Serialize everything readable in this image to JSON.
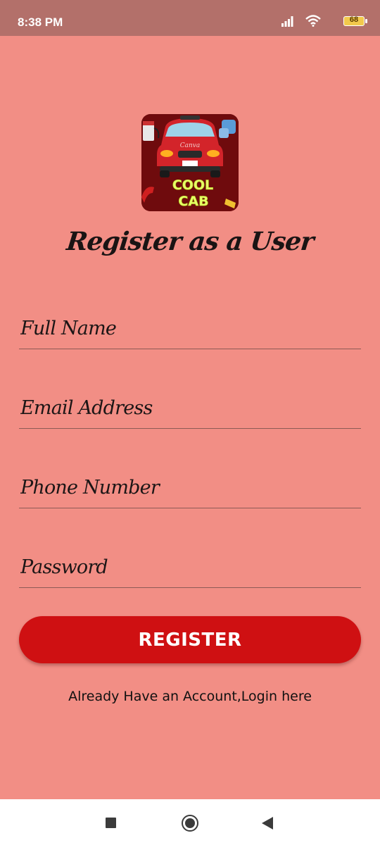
{
  "status_bar": {
    "time": "8:38 PM",
    "battery_level": "68",
    "icons": [
      "signal-icon",
      "wifi-icon",
      "battery-icon"
    ]
  },
  "logo": {
    "line1": "COOL",
    "line2": "CAB",
    "plate_text": "Canva"
  },
  "page": {
    "title": "Register as a User"
  },
  "form": {
    "full_name_placeholder": "Full Name",
    "email_placeholder": "Email Address",
    "phone_placeholder": "Phone Number",
    "password_placeholder": "Password",
    "register_label": "REGISTER",
    "login_link": "Already Have an Account,Login here"
  },
  "colors": {
    "background": "#f28e85",
    "status_bar": "#b3706a",
    "button": "#cf1012"
  },
  "nav_bar": {
    "buttons": [
      "recent-apps-icon",
      "home-icon",
      "back-icon"
    ]
  }
}
